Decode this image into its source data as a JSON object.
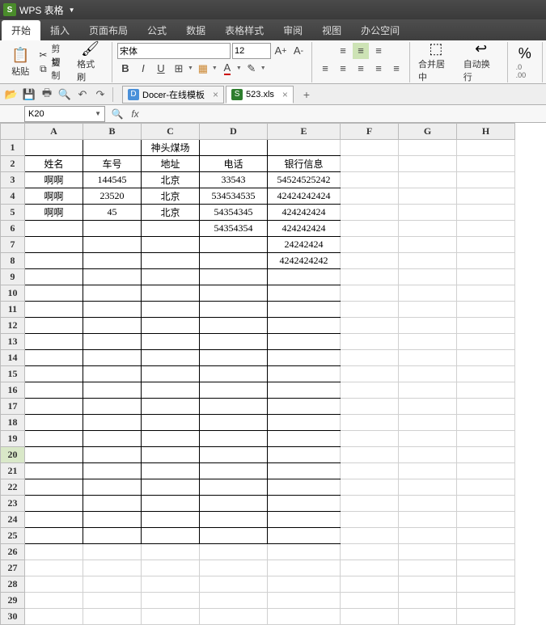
{
  "app": {
    "title": "WPS 表格"
  },
  "menu": {
    "items": [
      "开始",
      "插入",
      "页面布局",
      "公式",
      "数据",
      "表格样式",
      "审阅",
      "视图",
      "办公空间"
    ],
    "active_index": 0
  },
  "ribbon": {
    "paste": "粘贴",
    "cut": "剪切",
    "copy": "复制",
    "format_painter": "格式刷",
    "font_name": "宋体",
    "font_size": "12",
    "merge_center": "合并居中",
    "wrap_text": "自动换行",
    "percent": "%"
  },
  "tabs": [
    {
      "label": "Docer-在线模板",
      "icon": "docer"
    },
    {
      "label": "523.xls",
      "icon": "xls"
    }
  ],
  "namebox": "K20",
  "columns": [
    "A",
    "B",
    "C",
    "D",
    "E",
    "F",
    "G",
    "H"
  ],
  "row_count": 30,
  "selected_row": 20,
  "sheet": {
    "title": "神头煤场",
    "headers": [
      "姓名",
      "车号",
      "地址",
      "电话",
      "银行信息"
    ],
    "rows": [
      [
        "啊啊",
        "144545",
        "北京",
        "33543",
        "54524525242"
      ],
      [
        "啊啊",
        "23520",
        "北京",
        "534534535",
        "42424242424"
      ],
      [
        "啊啊",
        "45",
        "北京",
        "54354345",
        "424242424"
      ],
      [
        "",
        "",
        "",
        "54354354",
        "424242424"
      ],
      [
        "",
        "",
        "",
        "",
        "24242424"
      ],
      [
        "",
        "",
        "",
        "",
        "4242424242"
      ]
    ]
  }
}
